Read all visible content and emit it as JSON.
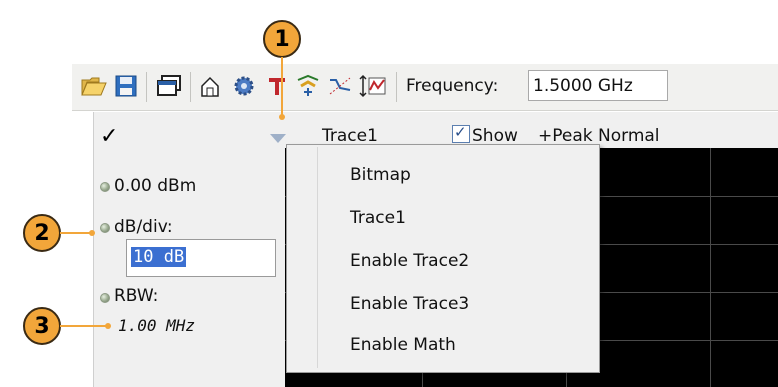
{
  "callouts": [
    "1",
    "2",
    "3"
  ],
  "toolbar": {
    "icons": [
      "open-folder-icon",
      "save-icon",
      "window-icon",
      "home-export-icon",
      "gear-icon",
      "text-marker-icon",
      "peak-marker-icon",
      "trace-icon",
      "scale-trace-icon"
    ],
    "frequency_label": "Frequency:",
    "frequency_value": "1.5000 GHz"
  },
  "panel": {
    "ref_level": "0.00 dBm",
    "db_div_label": "dB/div:",
    "db_div_value": "10 dB",
    "rbw_label": "RBW:",
    "rbw_value": "1.00 MHz"
  },
  "trace": {
    "name": "Trace1",
    "show_label": "Show",
    "detection": "+Peak Normal"
  },
  "context_menu": {
    "items": [
      "Bitmap",
      "Trace1",
      "Enable Trace2",
      "Enable Trace3",
      "Enable Math"
    ]
  },
  "colors": {
    "callout": "#f2a63a",
    "selection": "#3b6fd1",
    "graph_background": "#000000"
  }
}
